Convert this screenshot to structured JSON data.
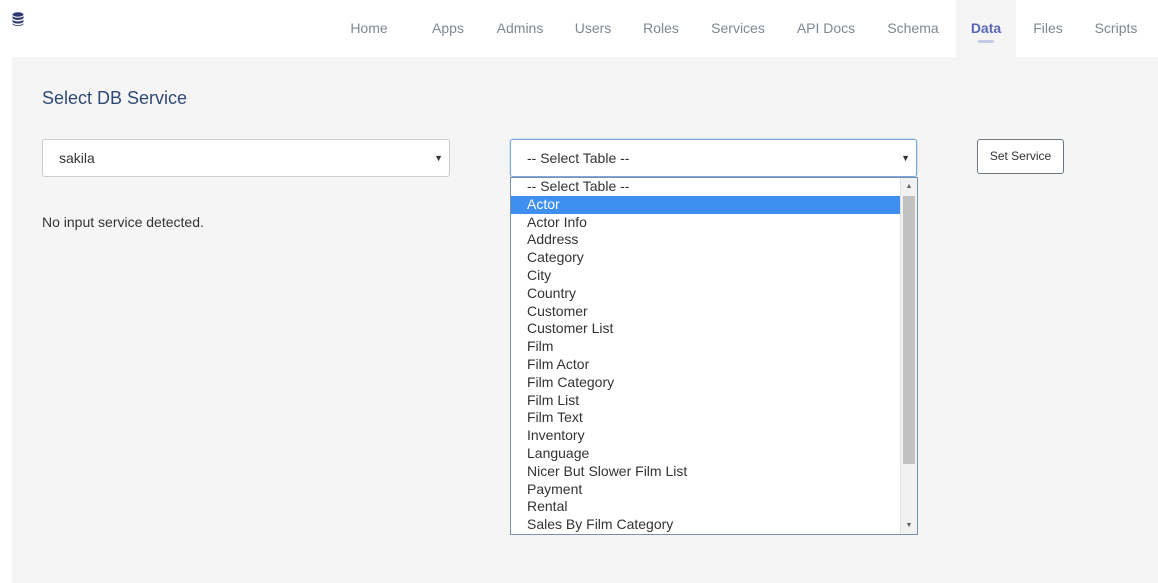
{
  "nav": {
    "logo_icon": "database-icon",
    "tabs": [
      "Home",
      "Apps",
      "Admins",
      "Users",
      "Roles",
      "Services",
      "API Docs",
      "Schema",
      "Data",
      "Files",
      "Scripts"
    ],
    "active": "Data"
  },
  "page": {
    "title": "Select DB Service",
    "notice": "No input service detected."
  },
  "service_select": {
    "value": "sakila"
  },
  "table_select": {
    "value": "-- Select Table --",
    "highlighted": "Actor",
    "options": [
      "-- Select Table --",
      "Actor",
      "Actor Info",
      "Address",
      "Category",
      "City",
      "Country",
      "Customer",
      "Customer List",
      "Film",
      "Film Actor",
      "Film Category",
      "Film List",
      "Film Text",
      "Inventory",
      "Language",
      "Nicer But Slower Film List",
      "Payment",
      "Rental",
      "Sales By Film Category"
    ]
  },
  "set_service_button": {
    "label": "Set Service"
  },
  "colors": {
    "accent": "#5a67b3",
    "highlight": "#3f8ff0",
    "title": "#2f4a72"
  }
}
